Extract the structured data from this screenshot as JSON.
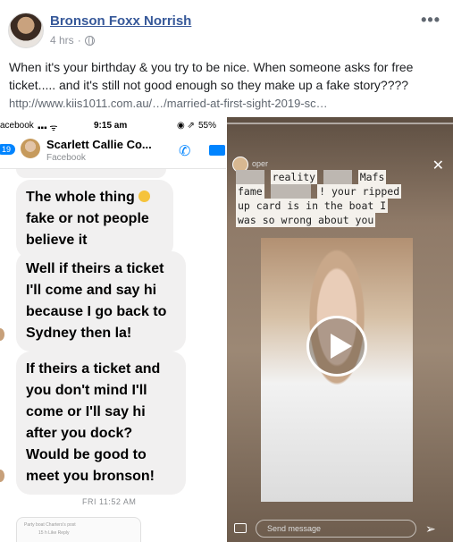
{
  "post": {
    "author": "Bronson Foxx Norrish",
    "time": "4 hrs",
    "more_label": "•••",
    "text": "When it's your birthday & you try to be nice. When someone asks for free ticket..... and it's still not good enough so they make up a fake story????",
    "link": "http://www.kiis1011.com.au/…/married-at-first-sight-2019-sc…"
  },
  "messenger": {
    "status_carrier": "acebook",
    "status_time": "9:15 am",
    "status_battery": "55%",
    "badge": "19",
    "contact_name": "Scarlett Callie Co...",
    "contact_sub": "Facebook",
    "messages": [
      "The whole thing",
      "fake or not people believe it",
      "Well if theirs a ticket I'll come and say hi because I go back to Sydney then la!",
      "If theirs a ticket  and you don't mind I'll come or I'll say hi after you dock? Would be good to meet you bronson!"
    ],
    "timestamp": "FRI 11:52 AM",
    "card_title": "Party boat Charters's post",
    "card_actions": "15 h   Like   Reply"
  },
  "story": {
    "user": "oper",
    "caption_line1_a": "reality",
    "caption_line1_b": "Mafs",
    "caption_line2_a": "fame",
    "caption_line2_b": "! your ripped",
    "caption_line3": "up card is in the boat I",
    "caption_line4": "was so wrong about you",
    "send_placeholder": "Send message"
  }
}
